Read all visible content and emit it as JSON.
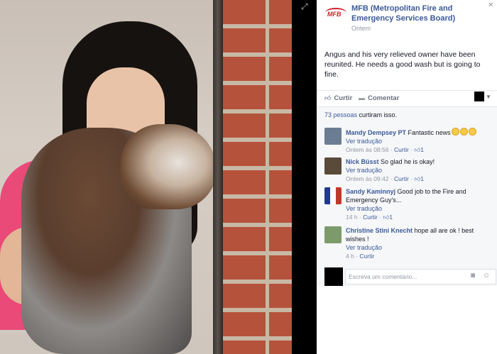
{
  "post": {
    "page_name": "MFB (Metropolitan Fire and Emergency Services Board)",
    "logo_text": "MFB",
    "time": "Ontem",
    "text": "Angus and his very relieved owner have been reunited. He needs a good wash but is going to fine.",
    "close_icon": "x-icon"
  },
  "actions": {
    "like_label": "Curtir",
    "comment_label": "Comentar",
    "like_icon": "thumb-up-icon",
    "comment_icon": "speech-bubble-icon",
    "share_icon": "caret-down-icon"
  },
  "likes": {
    "count_label": "73 pessoas",
    "rest_label": " curtiram isso."
  },
  "comments": [
    {
      "author": "Mandy Dempsey PT",
      "text": "Fantastic news",
      "translate": "Ver tradução",
      "time": "Ontem às 08:56",
      "like_label": "Curtir",
      "likes": "1",
      "avatar_color": "#6b7d93"
    },
    {
      "author": "Nick Büsst",
      "text": "So glad he is okay!",
      "translate": "Ver tradução",
      "time": "Ontem às 09:42",
      "like_label": "Curtir",
      "likes": "1",
      "avatar_color": "#5a4a3a"
    },
    {
      "author": "Sandy Kaminnyj",
      "text": "Good job to the Fire and Emergency Guy's...",
      "translate": "Ver tradução",
      "time": "14 h",
      "like_label": "Curtir",
      "likes": "1",
      "avatar_color": "#c0392b"
    },
    {
      "author": "Christine Stini Knecht",
      "text": "hope all are ok ! best wishes !",
      "translate": "Ver tradução",
      "time": "4 h",
      "like_label": "Curtir",
      "avatar_color": "#7d9b6a"
    }
  ],
  "write": {
    "placeholder": "Escreva um comentário..."
  },
  "colors": {
    "link": "#3b5998",
    "muted": "#9197a3",
    "brand_red": "#d0202a"
  }
}
